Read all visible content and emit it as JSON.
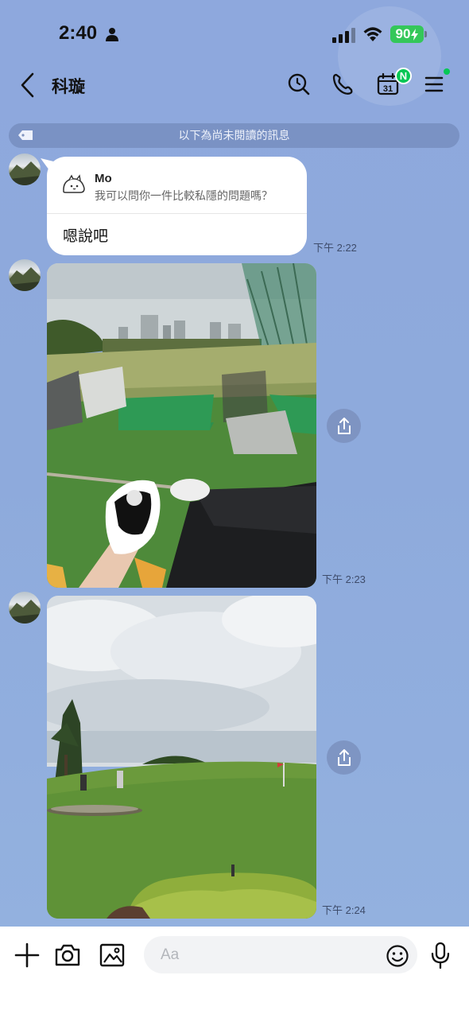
{
  "status_bar": {
    "time": "2:40",
    "battery": "90"
  },
  "header": {
    "title": "科璇",
    "calendar_date": "31",
    "calendar_badge": "N"
  },
  "unread_divider": {
    "text": "以下為尚未閱讀的訊息"
  },
  "messages": [
    {
      "type": "reply",
      "quoted_name": "Mo",
      "quoted_text": "我可以問你一件比較私隱的問題嗎？",
      "text": "嗯說吧",
      "time": "下午 2:22"
    },
    {
      "type": "photo",
      "time": "下午 2:23"
    },
    {
      "type": "photo",
      "time": "下午 2:24"
    }
  ],
  "input": {
    "placeholder": "Aa"
  },
  "colors": {
    "chat_background": "#8fa9dc",
    "line_green": "#06c755",
    "battery_green": "#34c759"
  }
}
